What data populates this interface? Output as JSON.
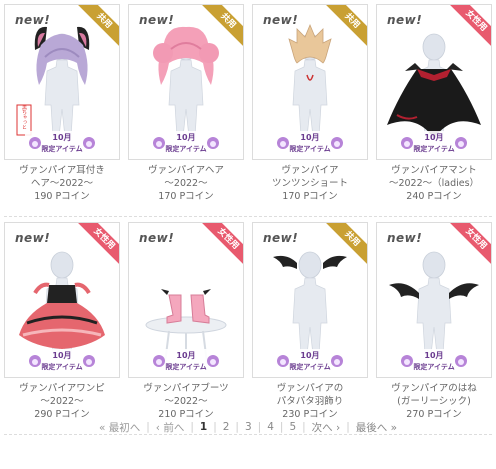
{
  "items": [
    {
      "new": "new!",
      "tag": "共用",
      "tag_color": "#c9a033",
      "name1": "ヴァンパイア耳付き",
      "name2": "ヘア～2022～",
      "price": "190 Pコイン",
      "badge_month": "10月",
      "badge_label": "限定アイテム",
      "stamp": "黒ちゃっと"
    },
    {
      "new": "new!",
      "tag": "共用",
      "tag_color": "#c9a033",
      "name1": "ヴァンパイアヘア",
      "name2": "～2022～",
      "price": "170 Pコイン",
      "badge_month": "10月",
      "badge_label": "限定アイテム"
    },
    {
      "new": "new!",
      "tag": "共用",
      "tag_color": "#c9a033",
      "name1": "ヴァンパイア",
      "name2": "ツンツンショート",
      "price": "170 Pコイン",
      "badge_month": "10月",
      "badge_label": "限定アイテム"
    },
    {
      "new": "new!",
      "tag": "女性用",
      "tag_color": "#e85a6e",
      "name1": "ヴァンパイアマント",
      "name2": "～2022～（ladies）",
      "price": "240 Pコイン",
      "badge_month": "10月",
      "badge_label": "限定アイテム"
    },
    {
      "new": "new!",
      "tag": "女性用",
      "tag_color": "#e85a6e",
      "name1": "ヴァンパイアワンピ",
      "name2": "～2022～",
      "price": "290 Pコイン",
      "badge_month": "10月",
      "badge_label": "限定アイテム"
    },
    {
      "new": "new!",
      "tag": "女性用",
      "tag_color": "#e85a6e",
      "name1": "ヴァンパイアブーツ",
      "name2": "～2022～",
      "price": "210 Pコイン",
      "badge_month": "10月",
      "badge_label": "限定アイテム"
    },
    {
      "new": "new!",
      "tag": "共用",
      "tag_color": "#c9a033",
      "name1": "ヴァンパイアの",
      "name2": "パタパタ羽飾り",
      "price": "230 Pコイン",
      "badge_month": "10月",
      "badge_label": "限定アイテム"
    },
    {
      "new": "new!",
      "tag": "女性用",
      "tag_color": "#e85a6e",
      "name1": "ヴァンパイアのはね",
      "name2": "(ガーリーシック)",
      "price": "270 Pコイン",
      "badge_month": "10月",
      "badge_label": "限定アイテム"
    }
  ],
  "pager": {
    "first": "« 最初へ",
    "prev": "‹ 前へ",
    "pages": [
      "1",
      "2",
      "3",
      "4",
      "5"
    ],
    "current": "1",
    "next": "次へ ›",
    "last": "最後へ »"
  }
}
